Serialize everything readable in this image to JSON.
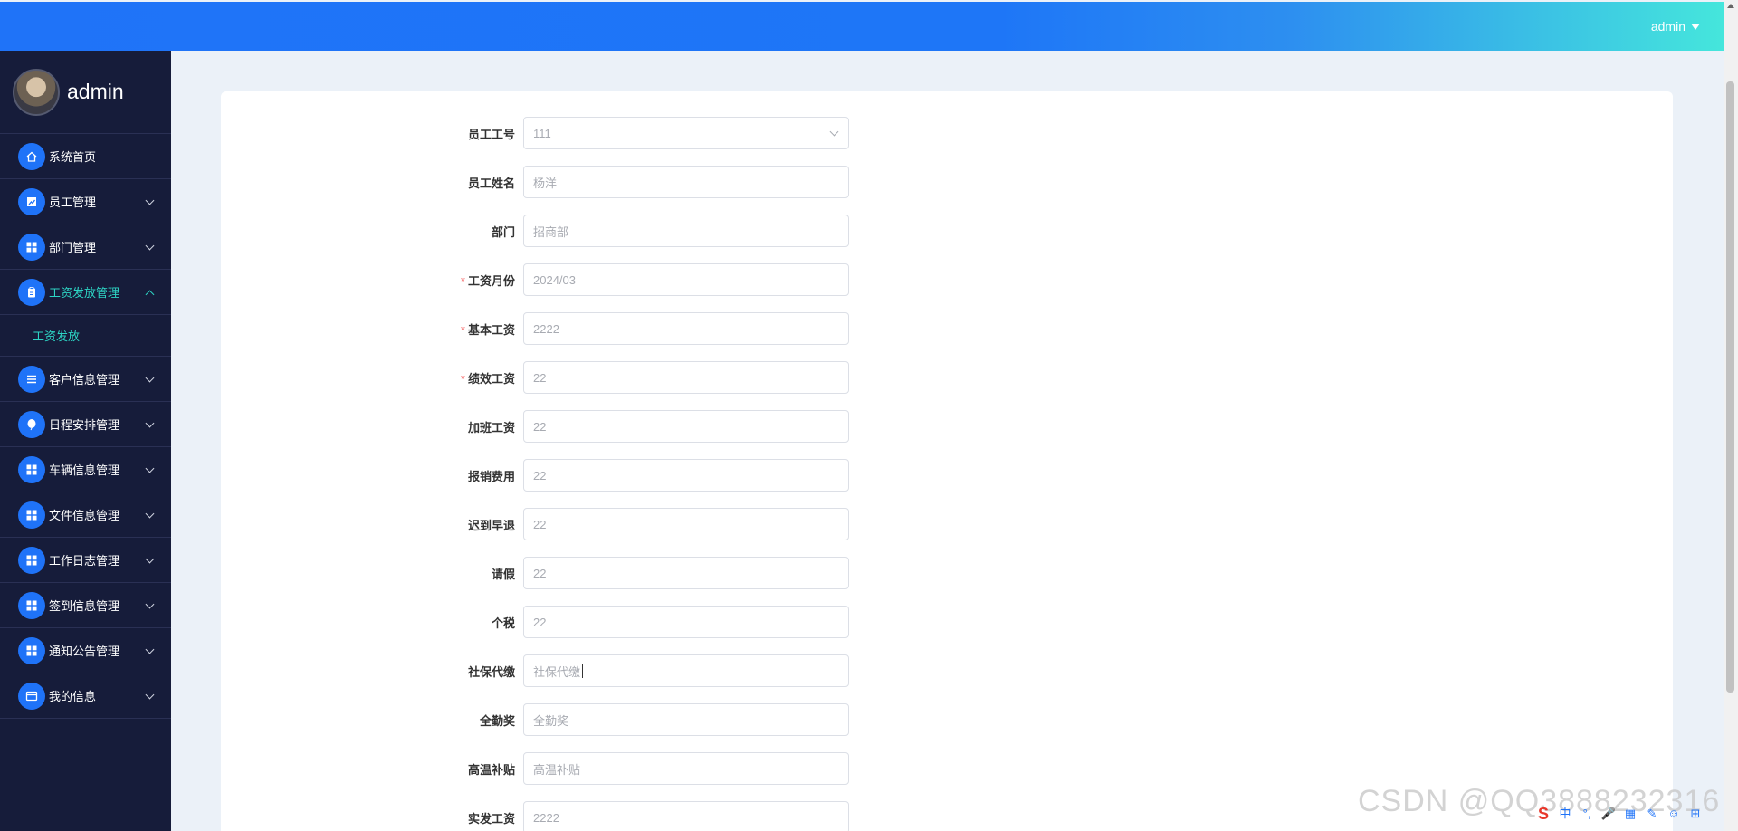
{
  "header": {
    "user": "admin"
  },
  "sidebar": {
    "username": "admin",
    "items": [
      {
        "label": "系统首页",
        "icon": "home-icon",
        "expandable": false
      },
      {
        "label": "员工管理",
        "icon": "chart-icon",
        "expandable": true
      },
      {
        "label": "部门管理",
        "icon": "grid-icon",
        "expandable": true
      },
      {
        "label": "工资发放管理",
        "icon": "clipboard-icon",
        "expandable": true,
        "active": true
      },
      {
        "label": "客户信息管理",
        "icon": "list-icon",
        "expandable": true
      },
      {
        "label": "日程安排管理",
        "icon": "balloon-icon",
        "expandable": true
      },
      {
        "label": "车辆信息管理",
        "icon": "grid-icon",
        "expandable": true
      },
      {
        "label": "文件信息管理",
        "icon": "grid-icon",
        "expandable": true
      },
      {
        "label": "工作日志管理",
        "icon": "grid-icon",
        "expandable": true
      },
      {
        "label": "签到信息管理",
        "icon": "grid-icon",
        "expandable": true
      },
      {
        "label": "通知公告管理",
        "icon": "grid-icon",
        "expandable": true
      },
      {
        "label": "我的信息",
        "icon": "card-icon",
        "expandable": true
      }
    ],
    "submenu": {
      "label": "工资发放"
    }
  },
  "form": {
    "fields": [
      {
        "label": "员工工号",
        "value": "111",
        "required": false,
        "type": "select"
      },
      {
        "label": "员工姓名",
        "value": "杨洋",
        "required": false
      },
      {
        "label": "部门",
        "value": "招商部",
        "required": false
      },
      {
        "label": "工资月份",
        "value": "2024/03",
        "required": true
      },
      {
        "label": "基本工资",
        "value": "2222",
        "required": true
      },
      {
        "label": "绩效工资",
        "value": "22",
        "required": true
      },
      {
        "label": "加班工资",
        "value": "22",
        "required": false
      },
      {
        "label": "报销费用",
        "value": "22",
        "required": false
      },
      {
        "label": "迟到早退",
        "value": "22",
        "required": false
      },
      {
        "label": "请假",
        "value": "22",
        "required": false
      },
      {
        "label": "个税",
        "value": "22",
        "required": false
      },
      {
        "label": "社保代缴",
        "value": "",
        "placeholder": "社保代缴",
        "required": false
      },
      {
        "label": "全勤奖",
        "value": "",
        "placeholder": "全勤奖",
        "required": false
      },
      {
        "label": "高温补贴",
        "value": "",
        "placeholder": "高温补贴",
        "required": false
      },
      {
        "label": "实发工资",
        "value": "2222",
        "required": false
      }
    ]
  },
  "watermark": "CSDN @QQ3888232316",
  "tray_icons": [
    "中",
    "°,",
    "🎤",
    "▦",
    "✎",
    "☺",
    "⊞"
  ]
}
